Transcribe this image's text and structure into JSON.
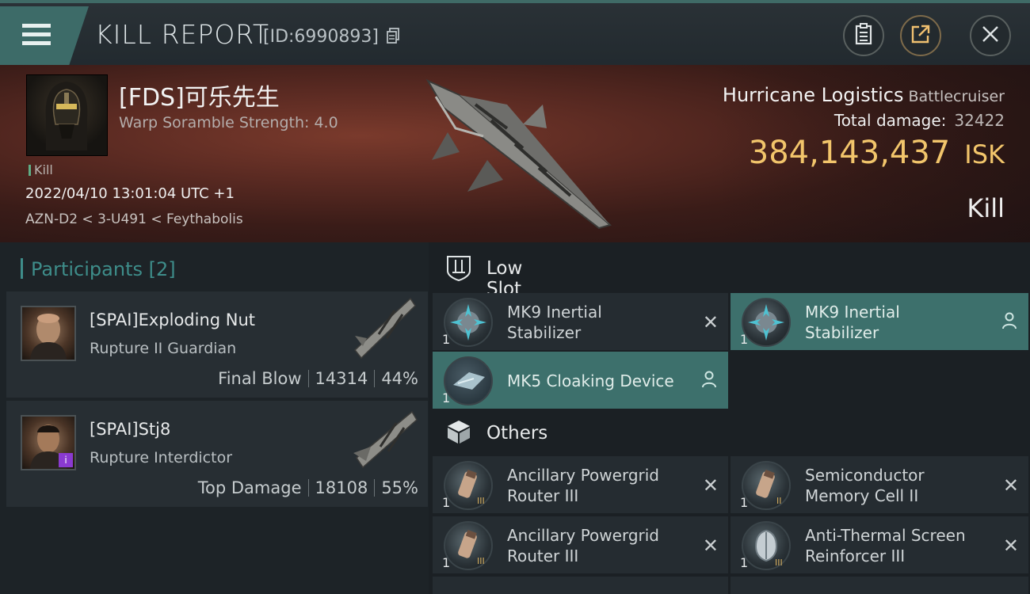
{
  "header": {
    "title": "KILL REPORT",
    "report_id": "[ID:6990893]"
  },
  "victim": {
    "name": "[FDS]可乐先生",
    "scramble": "Warp Soramble Strength: 4.0",
    "kill_tag": "Kill",
    "datetime": "2022/04/10 13:01:04 UTC +1",
    "location": "AZN-D2 < 3-U491 < Feythabolis",
    "ship_name": "Hurricane Logistics",
    "ship_class": "Battlecruiser",
    "total_damage_label": "Total damage:",
    "total_damage": "32422",
    "isk_value": "384,143,437",
    "isk_unit": "ISK",
    "result": "Kill"
  },
  "participants": {
    "title": "Participants",
    "count": "[2]",
    "rows": [
      {
        "name": "[SPAI]Exploding Nut",
        "ship": "Rupture II Guardian",
        "role": "Final Blow",
        "damage": "14314",
        "percent": "44%"
      },
      {
        "name": "[SPAI]Stj8",
        "ship": "Rupture Interdictor",
        "role": "Top Damage",
        "damage": "18108",
        "percent": "55%"
      }
    ]
  },
  "low_slot": {
    "title": "Low Slot",
    "items": [
      {
        "qty": "1",
        "name_line1": "MK9 Inertial",
        "name_line2": "Stabilizer",
        "status": "destroyed"
      },
      {
        "qty": "1",
        "name_line1": "MK9 Inertial",
        "name_line2": "Stabilizer",
        "status": "dropped"
      },
      {
        "qty": "1",
        "name_line1": "MK5 Cloaking Device",
        "name_line2": "",
        "status": "dropped"
      }
    ]
  },
  "others": {
    "title": "Others",
    "items": [
      {
        "qty": "1",
        "name_line1": "Ancillary Powergrid",
        "name_line2": "Router III",
        "status": "destroyed"
      },
      {
        "qty": "1",
        "name_line1": "Semiconductor",
        "name_line2": "Memory Cell II",
        "status": "destroyed"
      },
      {
        "qty": "1",
        "name_line1": "Ancillary Powergrid",
        "name_line2": "Router III",
        "status": "destroyed"
      },
      {
        "qty": "1",
        "name_line1": "Anti-Thermal Screen",
        "name_line2": "Reinforcer III",
        "status": "destroyed"
      }
    ]
  },
  "colors": {
    "accent": "#3d6b68",
    "isk": "#f2c56b",
    "highlight_slot": "#3d706c"
  },
  "icons": {
    "menu": "hamburger-icon",
    "copy": "copy-icon",
    "clipboard": "clipboard-icon",
    "share": "share-icon",
    "close": "close-icon",
    "low_slot": "low-slot-icon",
    "others": "cube-icon",
    "destroyed": "x-mark-icon",
    "dropped": "person-icon"
  }
}
